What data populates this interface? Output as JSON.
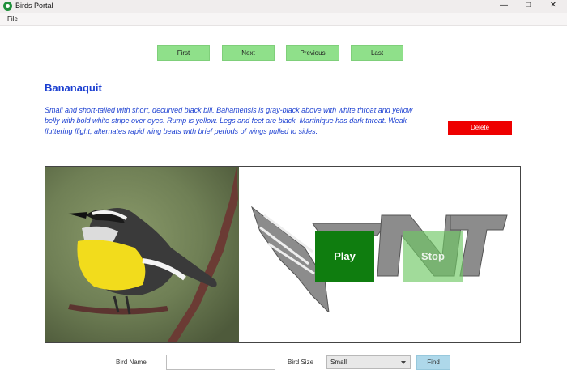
{
  "window": {
    "title": "Birds Portal",
    "minimize_icon": "—",
    "maximize_icon": "□",
    "close_icon": "✕"
  },
  "menu": {
    "file": "File"
  },
  "navigation": {
    "first": "First",
    "next": "Next",
    "previous": "Previous",
    "last": "Last"
  },
  "bird": {
    "name": "Bananaquit",
    "description": "Small and short-tailed with short, decurved black bill. Bahamensis is gray-black above with white throat and yellow belly with bold white stripe over eyes. Rump is yellow. Legs and feet are black. Martinique has dark throat. Weak fluttering flight, alternates rapid wing beats with brief periods of wings pulled to sides."
  },
  "actions": {
    "delete": "Delete",
    "play": "Play",
    "stop": "Stop"
  },
  "search": {
    "bird_name_label": "Bird Name",
    "bird_name_value": "",
    "bird_size_label": "Bird Size",
    "bird_size_selected": "Small",
    "find": "Find"
  },
  "colors": {
    "nav_button": "#8fe08a",
    "title_text": "#1b3fd1",
    "delete": "#ee0000",
    "play": "#0f7d0f",
    "find": "#aed8ea"
  }
}
